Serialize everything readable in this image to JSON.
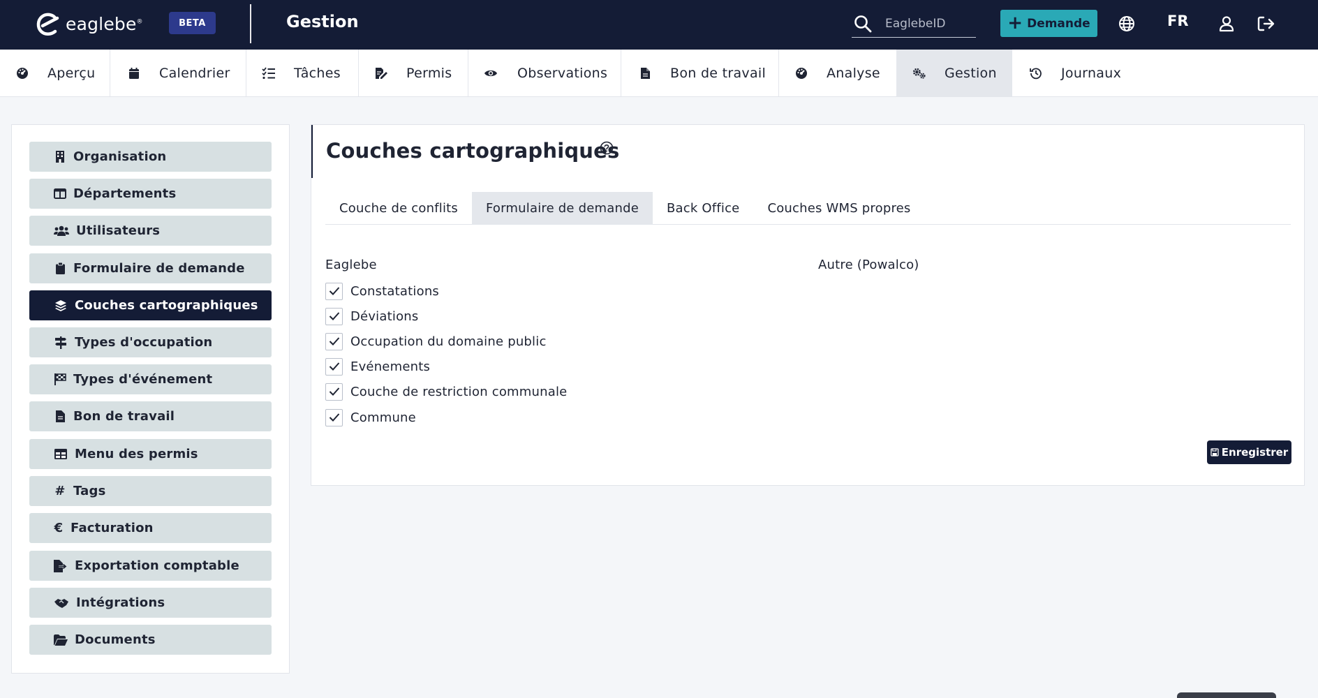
{
  "topbar": {
    "brand": "eaglebe",
    "brand_mark": "®",
    "badge": "BETA",
    "section_title": "Gestion",
    "search_placeholder": "EaglebeID",
    "new_request_label": "Demande",
    "language": "FR",
    "icons": [
      "search-icon",
      "plus-icon",
      "globe-icon",
      "user-icon",
      "logout-icon"
    ]
  },
  "nav": {
    "items": [
      {
        "label": "Aperçu",
        "icon": "dashboard-icon"
      },
      {
        "label": "Calendrier",
        "icon": "calendar-icon"
      },
      {
        "label": "Tâches",
        "icon": "tasks-icon"
      },
      {
        "label": "Permis",
        "icon": "permit-icon"
      },
      {
        "label": "Observations",
        "icon": "eye-icon"
      },
      {
        "label": "Bon de travail",
        "icon": "file-icon"
      },
      {
        "label": "Analyse",
        "icon": "gauge-icon"
      },
      {
        "label": "Gestion",
        "icon": "gears-icon",
        "active": true
      },
      {
        "label": "Journaux",
        "icon": "history-icon"
      }
    ]
  },
  "sidebar": {
    "items": [
      {
        "label": "Organisation",
        "icon": "building-icon"
      },
      {
        "label": "Départements",
        "icon": "columns-icon"
      },
      {
        "label": "Utilisateurs",
        "icon": "users-icon"
      },
      {
        "label": "Formulaire de demande",
        "icon": "clipboard-icon"
      },
      {
        "label": "Couches cartographiques",
        "icon": "layers-icon",
        "active": true
      },
      {
        "label": "Types d'occupation",
        "icon": "signs-icon"
      },
      {
        "label": "Types d'événement",
        "icon": "flag-checkered-icon"
      },
      {
        "label": "Bon de travail",
        "icon": "file-icon"
      },
      {
        "label": "Menu des permis",
        "icon": "table-icon"
      },
      {
        "label": "Tags",
        "icon": "hashtag-icon"
      },
      {
        "label": "Facturation",
        "icon": "euro-icon"
      },
      {
        "label": "Exportation comptable",
        "icon": "file-export-icon"
      },
      {
        "label": "Intégrations",
        "icon": "handshake-icon"
      },
      {
        "label": "Documents",
        "icon": "folder-open-icon"
      }
    ]
  },
  "main": {
    "title": "Couches cartographiques",
    "tabs": [
      {
        "label": "Couche de conflits"
      },
      {
        "label": "Formulaire de demande",
        "active": true
      },
      {
        "label": "Back Office"
      },
      {
        "label": "Couches WMS propres"
      }
    ],
    "left_column_label": "Eaglebe",
    "right_column_label": "Autre (Powalco)",
    "layers": [
      {
        "label": "Constatations",
        "checked": true
      },
      {
        "label": "Déviations",
        "checked": true
      },
      {
        "label": "Occupation du domaine public",
        "checked": true
      },
      {
        "label": "Evénements",
        "checked": true
      },
      {
        "label": "Couche de restriction communale",
        "checked": true
      },
      {
        "label": "Commune",
        "checked": true
      }
    ],
    "save_label": "Enregistrer"
  },
  "colors": {
    "navy": "#141c36",
    "teal": "#2aa9b6",
    "beta_badge": "#2d3a8c",
    "sidebar_item": "#d7e0e2",
    "active_tab": "#e4e7ec",
    "background": "#f4f6f9"
  }
}
